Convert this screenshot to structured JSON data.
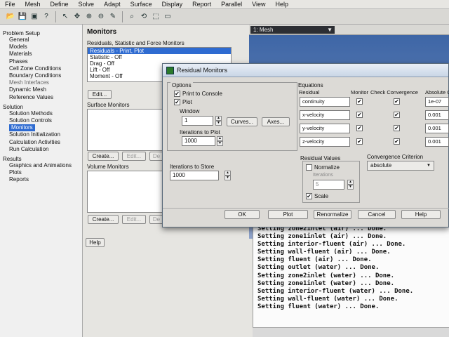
{
  "menu": [
    "File",
    "Mesh",
    "Define",
    "Solve",
    "Adapt",
    "Surface",
    "Display",
    "Report",
    "Parallel",
    "View",
    "Help"
  ],
  "toolbar_icons": [
    "open-icon",
    "save-icon",
    "print-icon",
    "help-icon",
    "select-icon",
    "move-icon",
    "zoom-in-icon",
    "zoom-out-icon",
    "probe-icon",
    "zoom-fit-icon",
    "rotate-icon",
    "region-icon",
    "layout-icon"
  ],
  "tree": {
    "problem_setup": "Problem Setup",
    "setup_items": [
      "General",
      "Models",
      "Materials",
      "Phases",
      "Cell Zone Conditions",
      "Boundary Conditions",
      "Mesh Interfaces",
      "Dynamic Mesh",
      "Reference Values"
    ],
    "solution": "Solution",
    "solution_items": [
      "Solution Methods",
      "Solution Controls",
      "Monitors",
      "Solution Initialization",
      "Calculation Activities",
      "Run Calculation"
    ],
    "results": "Results",
    "results_items": [
      "Graphics and Animations",
      "Plots",
      "Reports"
    ]
  },
  "monitors": {
    "title": "Monitors",
    "residuals_label": "Residuals, Statistic and Force Monitors",
    "residual_list": [
      "Residuals - Print, Plot",
      "Statistic - Off",
      "Drag - Off",
      "Lift - Off",
      "Moment - Off"
    ],
    "edit_button": "Edit...",
    "surface_label": "Surface Monitors",
    "volume_label": "Volume Monitors",
    "create_button": "Create...",
    "edit_button2": "Edit...",
    "delete_button": "De",
    "help_button": "Help"
  },
  "graphics": {
    "window_select": "1: Mesh"
  },
  "console_lines": [
    "Setting zone2inlet (air) ... Done.",
    "Setting zone1inlet (air) ... Done.",
    "Setting interior-fluent (air) ... Done.",
    "Setting wall-fluent (air) ... Done.",
    "Setting fluent (air) ... Done.",
    "Setting outlet (water) ... Done.",
    "Setting zone2inlet (water) ... Done.",
    "Setting zone1inlet (water) ... Done.",
    "Setting interior-fluent (water) ... Done.",
    "Setting wall-fluent (water) ... Done.",
    "Setting fluent (water) ... Done."
  ],
  "dialog": {
    "title": "Residual Monitors",
    "options_label": "Options",
    "print_to_console": "Print to Console",
    "plot": "Plot",
    "window_label": "Window",
    "window_value": "1",
    "curves_button": "Curves...",
    "axes_button": "Axes...",
    "iterations_to_plot_label": "Iterations to Plot",
    "iterations_to_plot_value": "1000",
    "iterations_to_store_label": "Iterations to Store",
    "iterations_to_store_value": "1000",
    "equations_label": "Equations",
    "col_residual": "Residual",
    "col_monitor": "Monitor",
    "col_check": "Check Convergence",
    "col_absolute": "Absolute C",
    "equations": [
      {
        "name": "continuity",
        "criteria": "1e-07"
      },
      {
        "name": "x-velocity",
        "criteria": "0.001"
      },
      {
        "name": "y-velocity",
        "criteria": "0.001"
      },
      {
        "name": "z-velocity",
        "criteria": "0.001"
      }
    ],
    "residual_values_label": "Residual Values",
    "normalize": "Normalize",
    "iterations_label": "Iterations",
    "iterations_value": "5",
    "scale": "Scale",
    "convergence_criterion_label": "Convergence Criterion",
    "convergence_criterion_value": "absolute",
    "buttons": {
      "ok": "OK",
      "plot": "Plot",
      "renormalize": "Renormalize",
      "cancel": "Cancel",
      "help": "Help"
    }
  }
}
